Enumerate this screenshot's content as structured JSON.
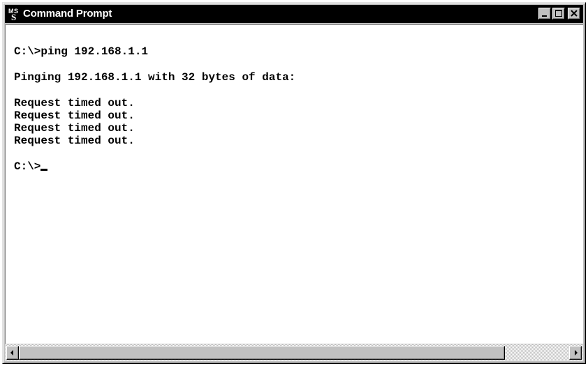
{
  "window": {
    "title": "Command Prompt",
    "icon": "ms-dos-icon",
    "icon_text": "MS"
  },
  "titlebar_buttons": {
    "minimize": "minimize-icon",
    "maximize": "maximize-icon",
    "close": "close-icon"
  },
  "console": {
    "lines": [
      "C:\\>ping 192.168.1.1",
      "Pinging 192.168.1.1 with 32 bytes of data:",
      "Request timed out.",
      "Request timed out.",
      "Request timed out.",
      "Request timed out.",
      "C:\\>"
    ]
  },
  "scrollbar": {
    "left_arrow": "arrow-left-icon",
    "right_arrow": "arrow-right-icon"
  },
  "colors": {
    "titlebar": "#000000",
    "title_text": "#ffffff",
    "console_bg": "#ffffff",
    "console_text": "#000000",
    "chrome": "#c0c0c0"
  }
}
